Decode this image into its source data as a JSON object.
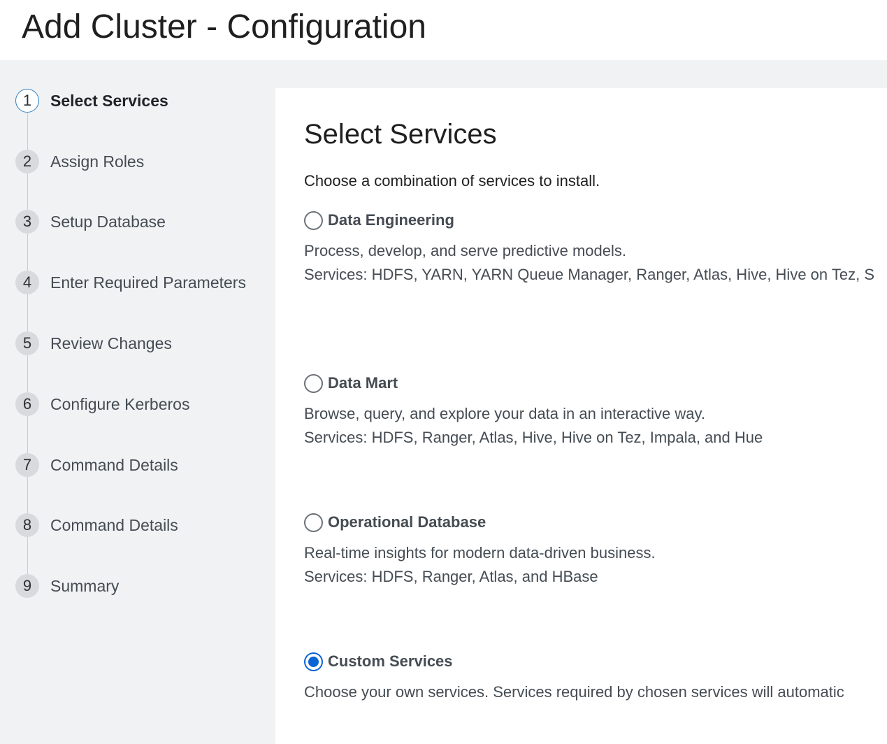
{
  "page": {
    "title": "Add Cluster - Configuration"
  },
  "wizard": {
    "active_step": 1,
    "steps": [
      {
        "number": "1",
        "label": "Select Services"
      },
      {
        "number": "2",
        "label": "Assign Roles"
      },
      {
        "number": "3",
        "label": "Setup Database"
      },
      {
        "number": "4",
        "label": "Enter Required Parameters"
      },
      {
        "number": "5",
        "label": "Review Changes"
      },
      {
        "number": "6",
        "label": "Configure Kerberos"
      },
      {
        "number": "7",
        "label": "Command Details"
      },
      {
        "number": "8",
        "label": "Command Details"
      },
      {
        "number": "9",
        "label": "Summary"
      }
    ]
  },
  "content": {
    "title": "Select Services",
    "subtitle": "Choose a combination of services to install.",
    "options": [
      {
        "name": "Data Engineering",
        "selected": false,
        "description": "Process, develop, and serve predictive models.",
        "services": "Services: HDFS, YARN, YARN Queue Manager, Ranger, Atlas, Hive, Hive on Tez, S"
      },
      {
        "name": "Data Mart",
        "selected": false,
        "description": "Browse, query, and explore your data in an interactive way.",
        "services": "Services: HDFS, Ranger, Atlas, Hive, Hive on Tez, Impala, and Hue"
      },
      {
        "name": "Operational Database",
        "selected": false,
        "description": "Real-time insights for modern data-driven business.",
        "services": "Services: HDFS, Ranger, Atlas, and HBase"
      },
      {
        "name": "Custom Services",
        "selected": true,
        "description": "Choose your own services. Services required by chosen services will automatic",
        "services": ""
      }
    ]
  },
  "colors": {
    "accent": "#0b63d6",
    "active_step_border": "#2f7fc1",
    "sidebar_bg": "#f1f2f4"
  }
}
